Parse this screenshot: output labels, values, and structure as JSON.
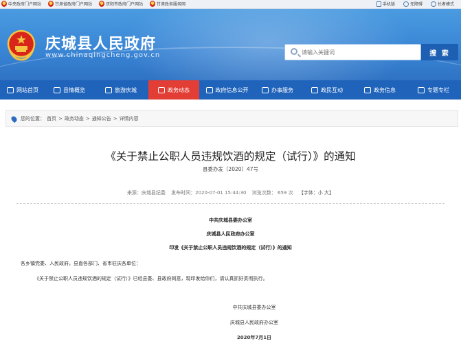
{
  "topbar": {
    "links": [
      "中央政府门户网站",
      "甘肃省政府门户网站",
      "庆阳市政府门户网站",
      "甘肃政务服务网"
    ],
    "mobile": "手机版",
    "accessible": "无障碍",
    "care": "长者模式"
  },
  "header": {
    "site_title": "庆城县人民政府",
    "site_url": "www.chinaqingcheng.gov.cn",
    "search_placeholder": "请输入关键词",
    "search_button": "搜 索"
  },
  "nav": {
    "items": [
      {
        "label": "网站首页",
        "icon": "home-icon",
        "active": false
      },
      {
        "label": "县情概览",
        "icon": "book-icon",
        "active": false
      },
      {
        "label": "旅游庆城",
        "icon": "leaf-icon",
        "active": false
      },
      {
        "label": "政务动态",
        "icon": "monitor-icon",
        "active": true
      },
      {
        "label": "政府信息公开",
        "icon": "document-icon",
        "active": false
      },
      {
        "label": "办事服务",
        "icon": "heart-hand-icon",
        "active": false
      },
      {
        "label": "政民互动",
        "icon": "chat-icon",
        "active": false
      },
      {
        "label": "政务信息",
        "icon": "list-icon",
        "active": false
      },
      {
        "label": "专题专栏",
        "icon": "bookmark-icon",
        "active": false
      }
    ]
  },
  "breadcrumb": {
    "prefix": "您的位置：",
    "items": [
      "首页",
      "政务动态",
      "通知公告",
      "详情内容"
    ],
    "separator": ">"
  },
  "article": {
    "title": "《关于禁止公职人员违规饮酒的规定（试行）》的通知",
    "doc_number": "县委办发〔2020〕47号",
    "meta": {
      "source": "来源：庆城县纪委",
      "publish_time": "发布时间：2020-07-01 15:44:30",
      "views": "浏览次数： 659 次",
      "font_size": "【字体：小 大】"
    },
    "issuer_1": "中共庆城县委办公室",
    "issuer_2": "庆城县人民政府办公室",
    "subject": "印发《关于禁止公职人员违规饮酒的规定（试行）》的通知",
    "salutation": "各乡镇党委、人民政府，县直各部门、省市驻庆各单位：",
    "body": "《关于禁止公职人员违规饮酒的规定（试行）》已经县委、县政府同意，现印发给你们，请认真抓好贯彻执行。",
    "sign_1": "中共庆城县委办公室",
    "sign_2": "庆城县人民政府办公室",
    "date": "2020年7月1日"
  },
  "colors": {
    "header_blue": "#3a86d6",
    "nav_blue": "#1f63bb",
    "nav_active_red": "#e23e35",
    "search_button": "#1d5fb3"
  }
}
